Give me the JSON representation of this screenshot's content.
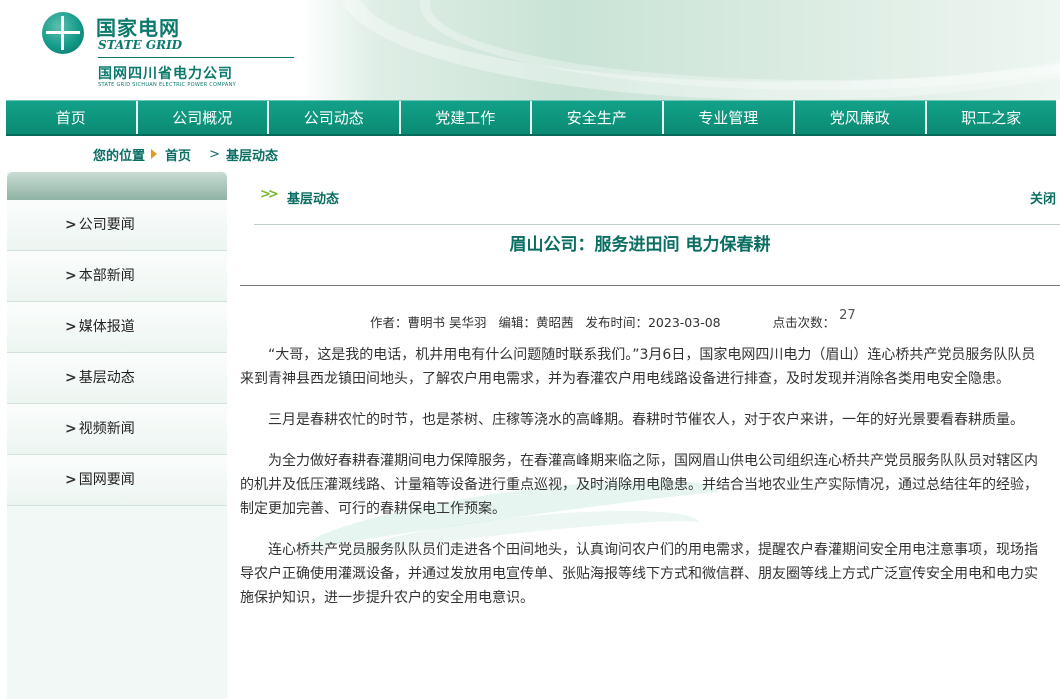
{
  "header": {
    "logo_cn": "国家电网",
    "logo_en": "STATE GRID",
    "logo_sub": "国网四川省电力公司",
    "logo_sub_en": "STATE GRID SICHUAN ELECTRIC POWER COMPANY"
  },
  "nav": {
    "items": [
      "首页",
      "公司概况",
      "公司动态",
      "党建工作",
      "安全生产",
      "专业管理",
      "党风廉政",
      "职工之家"
    ]
  },
  "breadcrumb": {
    "label": "您的位置",
    "home": "首页",
    "sep": ">",
    "current": "基层动态"
  },
  "sidebar": {
    "items": [
      "公司要闻",
      "本部新闻",
      "媒体报道",
      "基层动态",
      "视频新闻",
      "国网要闻"
    ]
  },
  "content": {
    "section": "基层动态",
    "close": "关闭",
    "title": "眉山公司：服务进田间 电力保春耕",
    "meta": {
      "author": "作者：曹明书 吴华羽",
      "editor": "编辑：黄昭茜",
      "date": "发布时间：2023-03-08",
      "views_label": "点击次数：",
      "views": "27"
    },
    "paragraphs": [
      "“大哥，这是我的电话，机井用电有什么问题随时联系我们。”3月6日，国家电网四川电力（眉山）连心桥共产党员服务队队员来到青神县西龙镇田间地头，了解农户用电需求，并为春灌农户用电线路设备进行排查，及时发现并消除各类用电安全隐患。",
      "三月是春耕农忙的时节，也是茶树、庄稼等浇水的高峰期。春耕时节催农人，对于农户来讲，一年的好光景要看春耕质量。",
      "为全力做好春耕春灌期间电力保障服务，在春灌高峰期来临之际，国网眉山供电公司组织连心桥共产党员服务队队员对辖区内的机井及低压灌溉线路、计量箱等设备进行重点巡视，及时消除用电隐患。并结合当地农业生产实际情况，通过总结往年的经验，制定更加完善、可行的春耕保电工作预案。",
      "连心桥共产党员服务队队员们走进各个田间地头，认真询问农户们的用电需求，提醒农户春灌期间安全用电注意事项，现场指导农户正确使用灌溉设备，并通过发放用电宣传单、张贴海报等线下方式和微信群、朋友圈等线上方式广泛宣传安全用电和电力实施保护知识，进一步提升农户的安全用电意识。"
    ]
  },
  "colors": {
    "brand": "#0b7a6c",
    "nav_bg": "#13a189",
    "accent_arrow": "#e39a1e",
    "section_arrow": "#76b82a"
  }
}
